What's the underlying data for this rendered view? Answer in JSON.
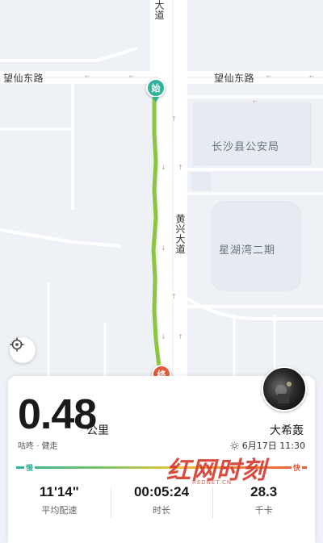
{
  "map": {
    "roads": {
      "top_vertical": "大道",
      "east_west_left": "望仙东路",
      "east_west_right": "望仙东路",
      "north_south": "黄兴大道"
    },
    "places": {
      "police": "长沙县公安局",
      "residence": "星湖湾二期"
    },
    "markers": {
      "start": "始",
      "end": "终"
    }
  },
  "activity": {
    "distance": "0.48",
    "distance_unit": "公里",
    "sub_label": "咕咚 · 健走",
    "username": "大希轰",
    "datetime": "6月17日 11:30",
    "pace": {
      "slow": "慢",
      "fast": "快"
    },
    "stats": [
      {
        "value": "11'14\"",
        "label": "平均配速"
      },
      {
        "value": "00:05:24",
        "label": "时长"
      },
      {
        "value": "28.3",
        "label": "千卡"
      }
    ]
  },
  "watermark": {
    "main": "红网时刻",
    "sub": "REDNET.CN"
  },
  "colors": {
    "track": "#8cc63f",
    "start": "#2fb39a",
    "end": "#e25a3c",
    "slow": "#2fb39a",
    "fast": "#e25a3c",
    "watermark": "#d63b2f"
  }
}
